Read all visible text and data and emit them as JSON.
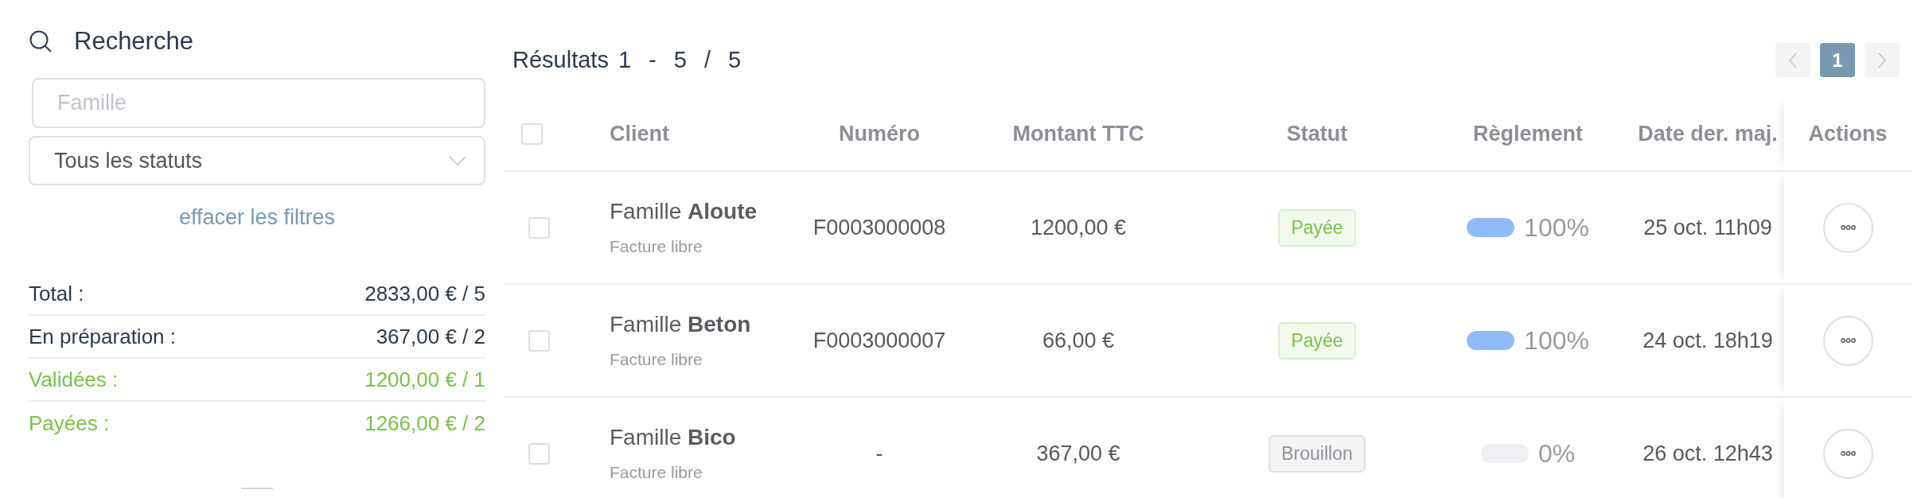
{
  "search": {
    "title": "Recherche",
    "family_field": {
      "placeholder": "Famille"
    },
    "status_select": {
      "value": "Tous les statuts"
    },
    "clear_filters": "effacer les filtres"
  },
  "summary": [
    {
      "label": "Total :",
      "value": "2833,00 € / 5",
      "color": "#2d3a4b"
    },
    {
      "label": "En préparation :",
      "value": "367,00 € / 2",
      "color": "#2d3a4b"
    },
    {
      "label": "Validées :",
      "value": "1200,00 € / 1",
      "color": "#7cc04b"
    },
    {
      "label": "Payées :",
      "value": "1266,00 € / 2",
      "color": "#7cc04b"
    }
  ],
  "results": {
    "label": "Résultats",
    "range": "1 - 5 / 5"
  },
  "pagination": {
    "previous": {
      "disabled": true
    },
    "pages": [
      {
        "label": "1",
        "selected": true
      }
    ],
    "next": {
      "disabled": true
    }
  },
  "table": {
    "select_all": {
      "checked": false
    },
    "columns": [
      "Client",
      "Numéro",
      "Montant TTC",
      "Statut",
      "Règlement",
      "Date der. maj.",
      "Actions"
    ],
    "rows": [
      {
        "selected": false,
        "client": "Famille **Aloute**",
        "type": "Facture libre",
        "number": "F0003000008",
        "amount": "1200,00 €",
        "status": {
          "label": "Payée",
          "color": "#7cc04b"
        },
        "payment": {
          "level": 1,
          "reading": "100%"
        },
        "updated": "25 oct. 11h09"
      },
      {
        "selected": false,
        "client": "Famille **Beton**",
        "type": "Facture libre",
        "number": "F0003000007",
        "amount": "66,00 €",
        "status": {
          "label": "Payée",
          "color": "#7cc04b"
        },
        "payment": {
          "level": 1,
          "reading": "100%"
        },
        "updated": "24 oct. 18h19"
      },
      {
        "selected": false,
        "client": "Famille **Bico**",
        "type": "Facture libre",
        "number": "-",
        "amount": "367,00 €",
        "status": {
          "label": "Brouillon",
          "color": "#909399"
        },
        "payment": {
          "level": 0,
          "reading": "0%"
        },
        "updated": "26 oct. 12h43"
      }
    ]
  }
}
